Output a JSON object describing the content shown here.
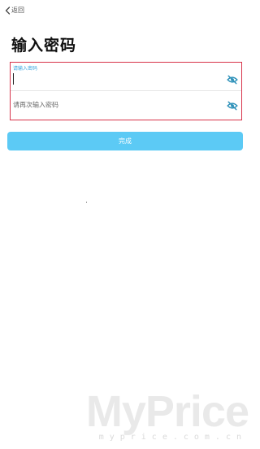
{
  "nav": {
    "back_label": "返回",
    "back_icon": "chevron-left-icon"
  },
  "page": {
    "title": "输入密码"
  },
  "form": {
    "password": {
      "label": "请输入密码",
      "value": "",
      "visibility_icon": "eye-slash-icon"
    },
    "confirm_password": {
      "placeholder": "请再次输入密码",
      "value": "",
      "visibility_icon": "eye-slash-icon"
    },
    "highlight_color": "#d8334a"
  },
  "actions": {
    "done_label": "完成",
    "done_color": "#5ccaf5"
  },
  "watermark": {
    "logo": "MyPrice",
    "url": "myprice.com.cn"
  },
  "colors": {
    "accent": "#39a6e0",
    "icon": "#2a8fb8"
  }
}
